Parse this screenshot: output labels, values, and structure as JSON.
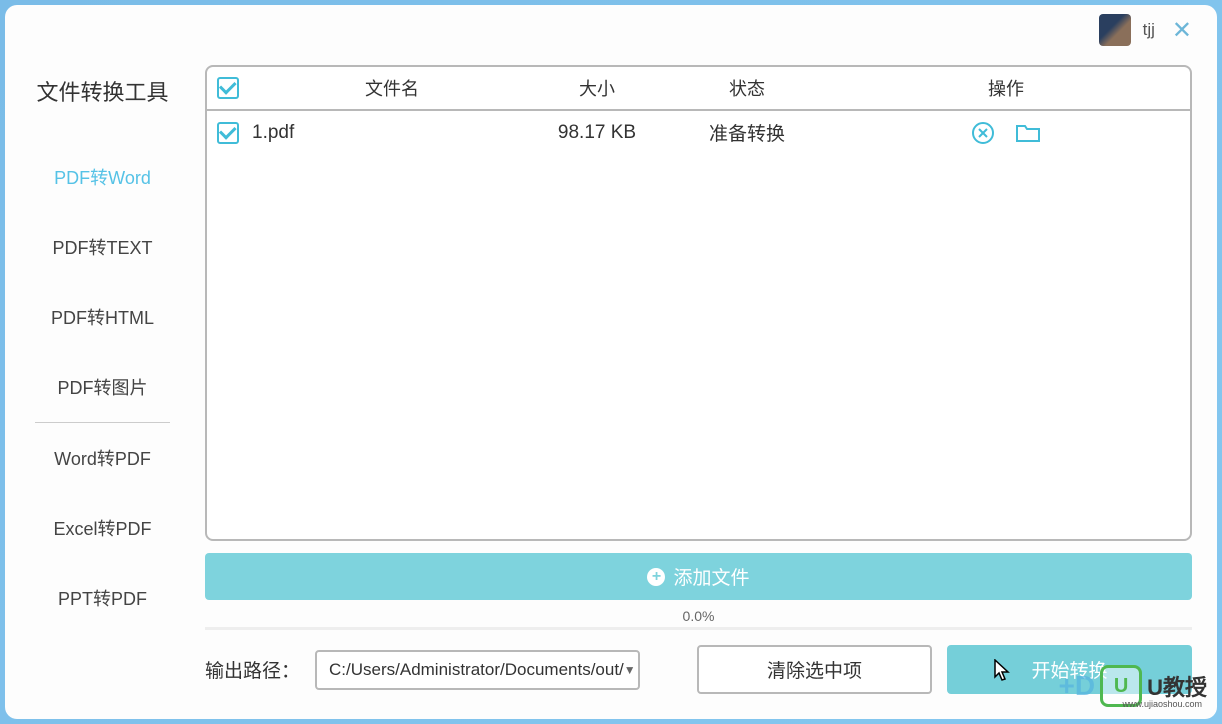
{
  "titlebar": {
    "username": "tjj"
  },
  "sidebar": {
    "title": "文件转换工具",
    "items": [
      {
        "label": "PDF转Word",
        "active": true
      },
      {
        "label": "PDF转TEXT",
        "active": false
      },
      {
        "label": "PDF转HTML",
        "active": false
      },
      {
        "label": "PDF转图片",
        "active": false
      },
      {
        "label": "Word转PDF",
        "active": false
      },
      {
        "label": "Excel转PDF",
        "active": false
      },
      {
        "label": "PPT转PDF",
        "active": false
      }
    ]
  },
  "table": {
    "headers": {
      "filename": "文件名",
      "size": "大小",
      "status": "状态",
      "action": "操作"
    },
    "rows": [
      {
        "filename": "1.pdf",
        "size": "98.17 KB",
        "status": "准备转换",
        "checked": true
      }
    ]
  },
  "addFile": "添加文件",
  "progress": "0.0%",
  "bottom": {
    "outputLabel": "输出路径：",
    "path": "C:/Users/Administrator/Documents/out/",
    "clearBtn": "清除选中项",
    "startBtn": "开始转换"
  },
  "watermark": {
    "text1": "+D",
    "badge": "U",
    "text2": "U教授",
    "sub": "www.ujiaoshou.com"
  }
}
